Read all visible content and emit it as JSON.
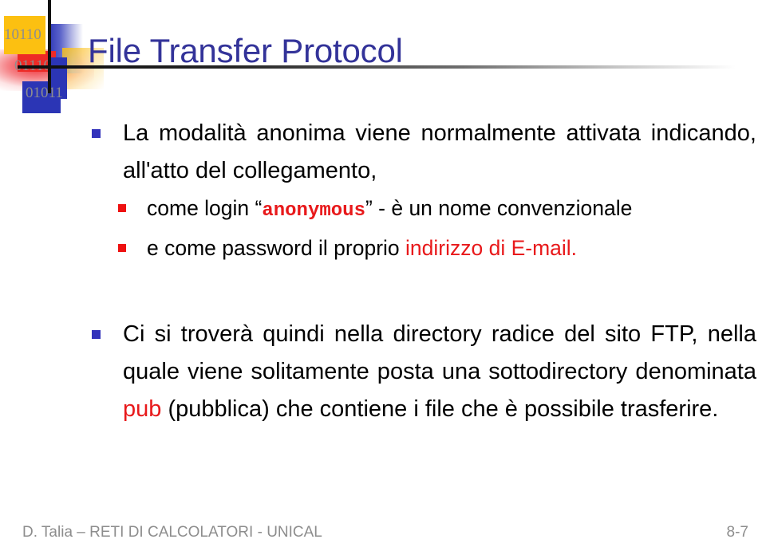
{
  "slide": {
    "title": "File Transfer Protocol",
    "title_color": "#333399",
    "background": "#ffffff"
  },
  "logo": {
    "binary_lines": [
      "10110",
      "01110",
      "01011"
    ],
    "colors": {
      "yellow": "#fcc011",
      "red": "#ee2a26",
      "blue": "#2b35b5",
      "binary_text": "#8e8e8e"
    }
  },
  "content": {
    "bullets": [
      {
        "level": 1,
        "bullet_color": "#3333bb",
        "text": "La modalità anonima viene normalmente attivata indicando, all'atto del collegamento,"
      },
      {
        "level": 2,
        "bullet_color": "#ee1111",
        "text_before": "come login “",
        "highlight": "anonymous",
        "highlight_color": "#e8191b",
        "text_after": "” - è un nome convenzionale"
      },
      {
        "level": 2,
        "bullet_color": "#ee1111",
        "text_before": "e come password il proprio ",
        "highlight": "indirizzo di E-mail.",
        "highlight_color": "#e8191b",
        "text_after": ""
      },
      {
        "level": 1,
        "bullet_color": "#3333bb",
        "text_before": "Ci si troverà quindi nella directory radice del sito FTP, nella quale viene solitamente posta una sottodirectory denominata ",
        "highlight": "pub",
        "highlight_color": "#e8191b",
        "text_after": " (pubblica) che contiene i file che è possibile trasferire."
      }
    ]
  },
  "footer": {
    "left": "D. Talia – RETI DI CALCOLATORI - UNICAL",
    "right": "8-7",
    "color": "#8d8d8d"
  }
}
